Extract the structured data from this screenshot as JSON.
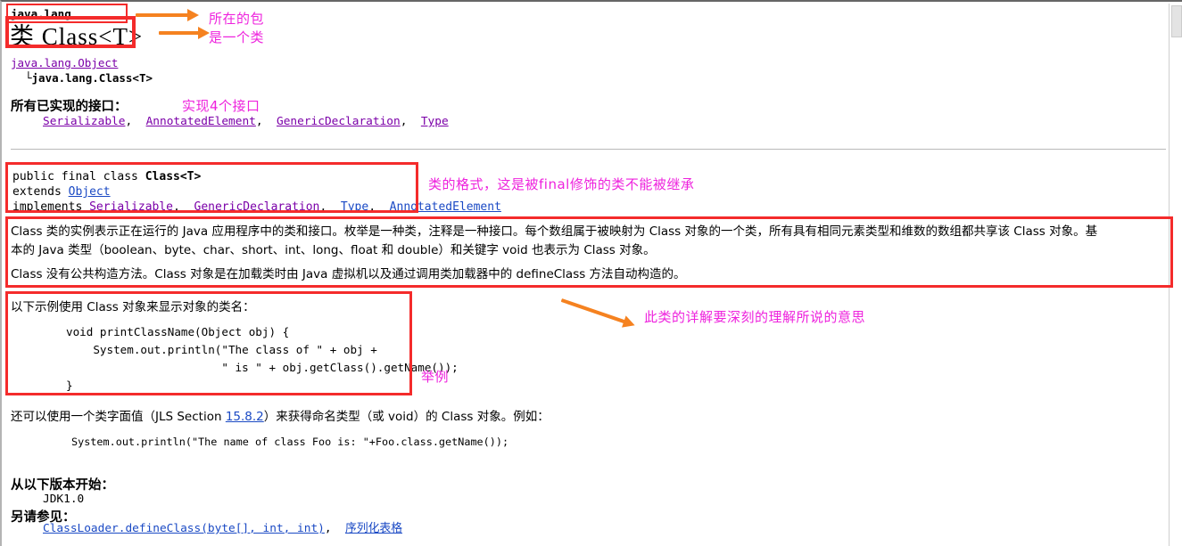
{
  "page": {
    "package_label": "java.lang",
    "class_title": "类 Class<T>",
    "hierarchy": {
      "parent": "java.lang.Object",
      "branch_prefix": "└",
      "child": "java.lang.Class<T>"
    },
    "interfaces_heading": "所有已实现的接口：",
    "interfaces": [
      {
        "label": "Serializable",
        "sep": ","
      },
      {
        "label": "AnnotatedElement",
        "sep": ","
      },
      {
        "label": "GenericDeclaration",
        "sep": ","
      },
      {
        "label": "Type",
        "sep": ""
      }
    ],
    "signature": {
      "line1_pre": "public final class ",
      "line1_name": "Class<T>",
      "line2_pre": "extends ",
      "line2_link": "Object",
      "line3_pre": "implements ",
      "line3_links": [
        "Serializable",
        "GenericDeclaration",
        "Type",
        "AnnotatedElement"
      ]
    },
    "description": {
      "para1_line1": "Class 类的实例表示正在运行的 Java 应用程序中的类和接口。枚举是一种类，注释是一种接口。每个数组属于被映射为 Class 对象的一个类，所有具有相同元素类型和维数的数组都共享该 Class 对象。基",
      "para1_line2": "本的 Java 类型（boolean、byte、char、short、int、long、float 和 double）和关键字 void 也表示为 Class 对象。",
      "para2": "Class 没有公共构造方法。Class 对象是在加载类时由 Java 虚拟机以及通过调用类加载器中的 defineClass 方法自动构造的。"
    },
    "example": {
      "intro": "以下示例使用 Class 对象来显示对象的类名：",
      "code": "void printClassName(Object obj) {\n    System.out.println(\"The class of \" + obj +\n                       \" is \" + obj.getClass().getName());\n}"
    },
    "literal": {
      "line_part1": "还可以使用一个类字面值（JLS Section ",
      "line_link": "15.8.2",
      "line_part2": "）来获得命名类型（或 void）的 Class 对象。例如：",
      "code": "System.out.println(\"The name of class Foo is: \"+Foo.class.getName());"
    },
    "since": {
      "heading": "从以下版本开始：",
      "value": "JDK1.0"
    },
    "seealso": {
      "heading": "另请参见：",
      "links": [
        "ClassLoader.defineClass(byte[], int, int)",
        "序列化表格"
      ],
      "separator": ","
    }
  },
  "annotations": {
    "notes": [
      {
        "id": "note-package",
        "text": "所在的包"
      },
      {
        "id": "note-is-a-class",
        "text": "是一个类"
      },
      {
        "id": "note-interfaces",
        "text": "实现4个接口"
      },
      {
        "id": "note-class-format",
        "text": "类的格式，这是被final修饰的类不能被继承"
      },
      {
        "id": "note-detail",
        "text": "此类的详解要深刻的理解所说的意思"
      },
      {
        "id": "note-example",
        "text": "举例"
      }
    ],
    "colors": {
      "box_red": "#f42b2b",
      "note_magenta": "#ee22dd",
      "arrow_orange": "#f58220",
      "link_blue": "#1a49c4",
      "link_purple": "#7b00a8"
    },
    "boxes": [
      {
        "id": "box-package",
        "label": "java.lang 包名框"
      },
      {
        "id": "box-title",
        "label": "类标题框"
      },
      {
        "id": "box-signature",
        "label": "类声明框"
      },
      {
        "id": "box-description",
        "label": "类详解框"
      },
      {
        "id": "box-example",
        "label": "示例代码框"
      }
    ],
    "arrows": [
      {
        "id": "arrow-to-package",
        "label": "指向包名"
      },
      {
        "id": "arrow-to-title",
        "label": "指向类标题"
      },
      {
        "id": "arrow-to-detail",
        "label": "指向详解框"
      }
    ]
  }
}
